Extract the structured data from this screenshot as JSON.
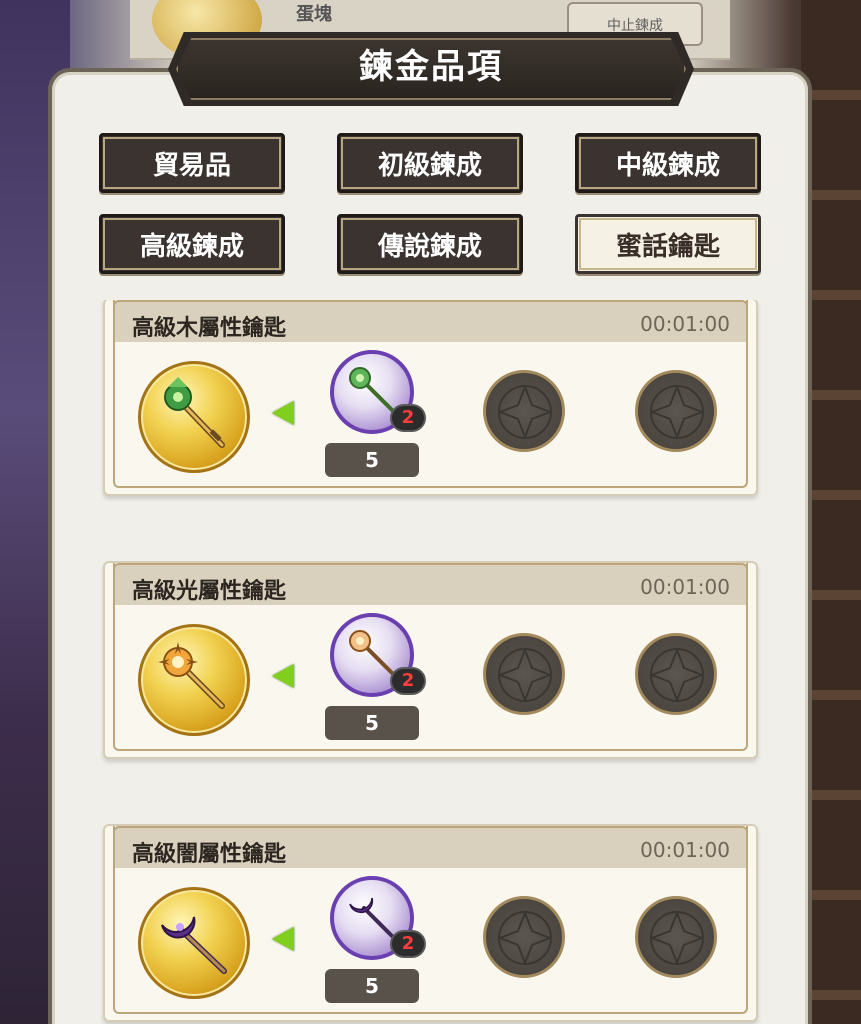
{
  "background": {
    "top_label": "蛋塊",
    "top_button": "中止鍊成"
  },
  "panel": {
    "title": "鍊金品項"
  },
  "tabs": [
    {
      "label": "貿易品",
      "active": false
    },
    {
      "label": "初級鍊成",
      "active": false
    },
    {
      "label": "中級鍊成",
      "active": false
    },
    {
      "label": "高級鍊成",
      "active": false
    },
    {
      "label": "傳說鍊成",
      "active": false
    },
    {
      "label": "蜜話鑰匙",
      "active": true
    }
  ],
  "recipes": [
    {
      "name": "高級木屬性鑰匙",
      "time": "00:01:00",
      "result_icon": "wood-key-icon",
      "material_icon": "wood-key-icon",
      "material_badge": "2",
      "material_count": "5"
    },
    {
      "name": "高級光屬性鑰匙",
      "time": "00:01:00",
      "result_icon": "light-key-icon",
      "material_icon": "light-key-icon",
      "material_badge": "2",
      "material_count": "5"
    },
    {
      "name": "高級闇屬性鑰匙",
      "time": "00:01:00",
      "result_icon": "dark-key-icon",
      "material_icon": "dark-key-icon",
      "material_badge": "2",
      "material_count": "5"
    }
  ],
  "colors": {
    "accent_green": "#7fcf1c",
    "badge_red": "#ff3d3d",
    "tab_dark": "#3a3330",
    "tab_active": "#f5f1e4"
  }
}
